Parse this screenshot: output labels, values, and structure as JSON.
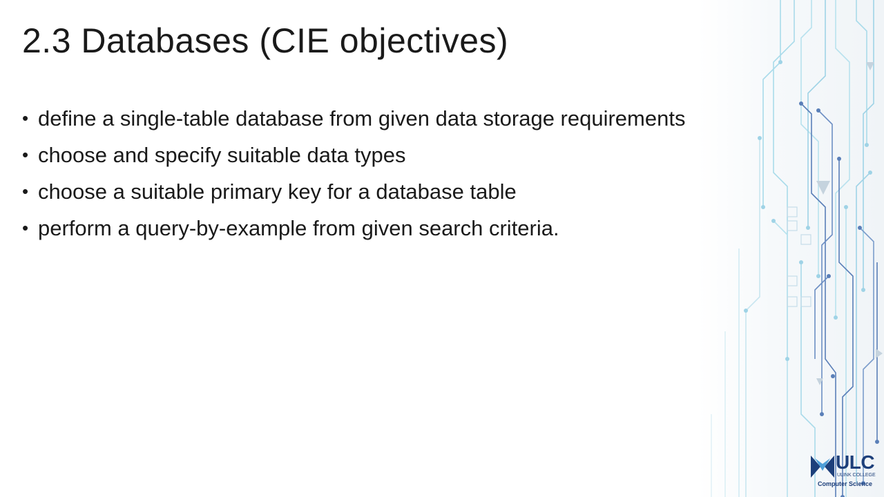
{
  "slide": {
    "title": "2.3 Databases (CIE objectives)",
    "bullets": [
      "define a single-table database from given data storage requirements",
      "choose and specify suitable data types",
      "choose a suitable primary key for a database table",
      "perform a query-by-example from given search criteria."
    ],
    "bullet_glyph": "•"
  },
  "logo": {
    "brand": "ULC",
    "college": "ULINK COLLEGE",
    "dept": "Computer Science",
    "color": "#1d3f7a"
  },
  "decoration": {
    "icon": "circuit-board-pattern",
    "colors": [
      "#9fd3e6",
      "#5a7fb8",
      "#c9e6f0"
    ]
  }
}
